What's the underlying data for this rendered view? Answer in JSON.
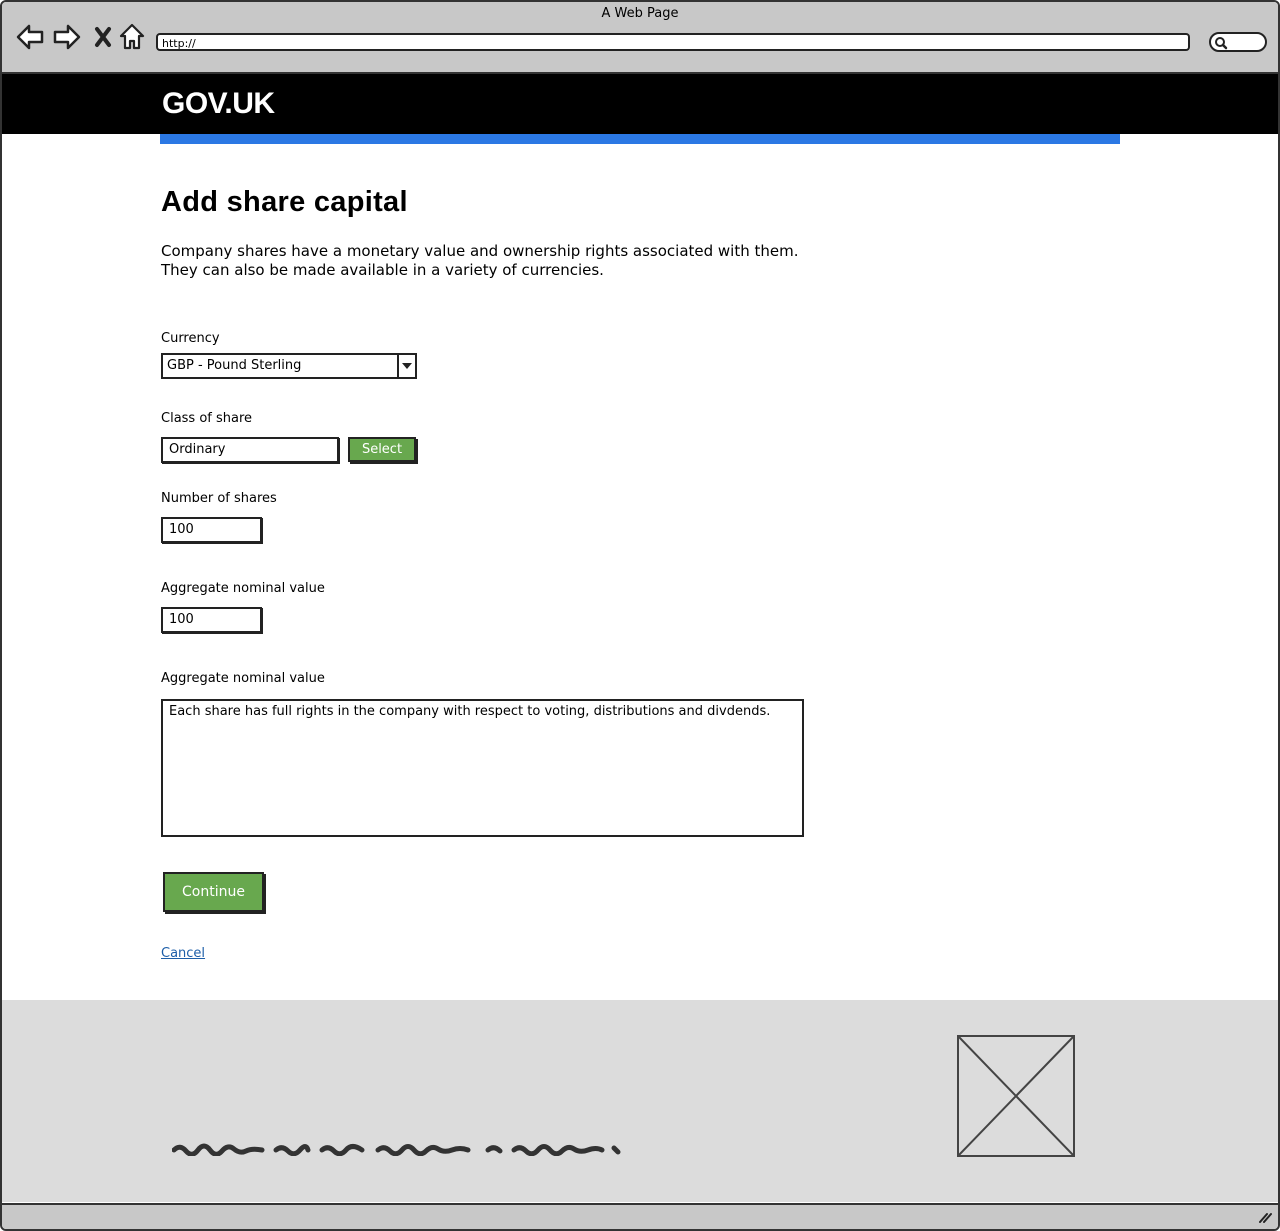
{
  "browser": {
    "window_title": "A Web Page",
    "address_bar": "http://"
  },
  "header": {
    "logo": "GOV.UK"
  },
  "page": {
    "title": "Add share capital",
    "intro_line1": "Company shares have a monetary value and ownership rights associated with them.",
    "intro_line2": "They can also be made available in a variety of currencies."
  },
  "form": {
    "currency": {
      "label": "Currency",
      "value": "GBP - Pound Sterling"
    },
    "share_class": {
      "label": "Class of share",
      "value": "Ordinary",
      "button_label": "Select"
    },
    "number_of_shares": {
      "label": "Number of shares",
      "value": "100"
    },
    "aggregate_value": {
      "label": "Aggregate nominal value",
      "value": "100"
    },
    "rights": {
      "label": "Aggregate nominal value",
      "value": "Each share has full rights in the company with respect to voting, distributions and divdends."
    },
    "continue_label": "Continue",
    "cancel_label": "Cancel"
  },
  "icons": {
    "back": "back-arrow-icon",
    "forward": "forward-arrow-icon",
    "stop": "close-icon",
    "home": "home-icon",
    "search": "search-icon",
    "image_placeholder": "image-placeholder-icon",
    "resize": "resize-grip-icon"
  },
  "colors": {
    "header_bg": "#000000",
    "accent_blue": "#2b78e4",
    "button_green": "#68a84e",
    "link": "#1d5ea8",
    "footer_bg": "#dcdcdc"
  }
}
